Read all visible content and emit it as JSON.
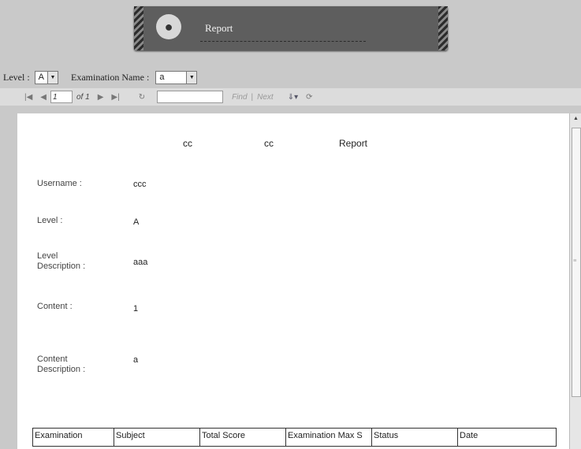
{
  "banner": {
    "title": "Report"
  },
  "filters": {
    "level_label": "Level :",
    "level_value": "A",
    "exam_label": "Examination Name :",
    "exam_value": "a"
  },
  "toolbar": {
    "first_icon": "first-page-icon",
    "prev_icon": "prev-page-icon",
    "page_input": "1",
    "page_of": "of 1",
    "next_icon": "next-page-icon",
    "last_icon": "last-page-icon",
    "find_label": "Find",
    "separator": "|",
    "next_label": "Next"
  },
  "report": {
    "header": [
      "cc",
      "cc",
      "Report"
    ],
    "fields": [
      {
        "label": "Username :",
        "value": "ccc"
      },
      {
        "label": "Level :",
        "value": "A"
      },
      {
        "label": "Level Description :",
        "value": "aaa"
      },
      {
        "label": "Content :",
        "value": "1"
      },
      {
        "label": "Content Description :",
        "value": "a"
      }
    ],
    "table_headers": [
      "Examination",
      "Subject",
      "Total Score",
      "Examination Max S",
      "Status",
      "Date"
    ]
  }
}
